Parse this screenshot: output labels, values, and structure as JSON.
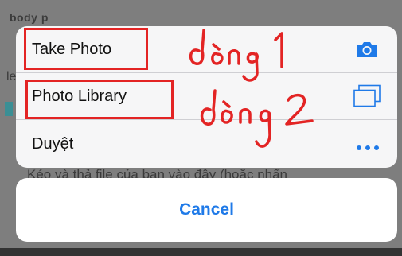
{
  "background": {
    "breadcrumb": "body   p",
    "edge_letter": "le",
    "drop_text": "Kéo và thả file của bạn vào đây (hoặc nhấn"
  },
  "action_sheet": {
    "items": [
      {
        "label": "Take Photo",
        "icon": "camera-icon"
      },
      {
        "label": "Photo Library",
        "icon": "photo-library-icon"
      },
      {
        "label": "Duyệt",
        "icon": "more-dots-icon"
      }
    ],
    "cancel_label": "Cancel",
    "accent_color": "#1f7ae8"
  },
  "annotations": {
    "line1": "dòng 1",
    "line2": "dòng 2",
    "ink_color": "#e32424"
  }
}
